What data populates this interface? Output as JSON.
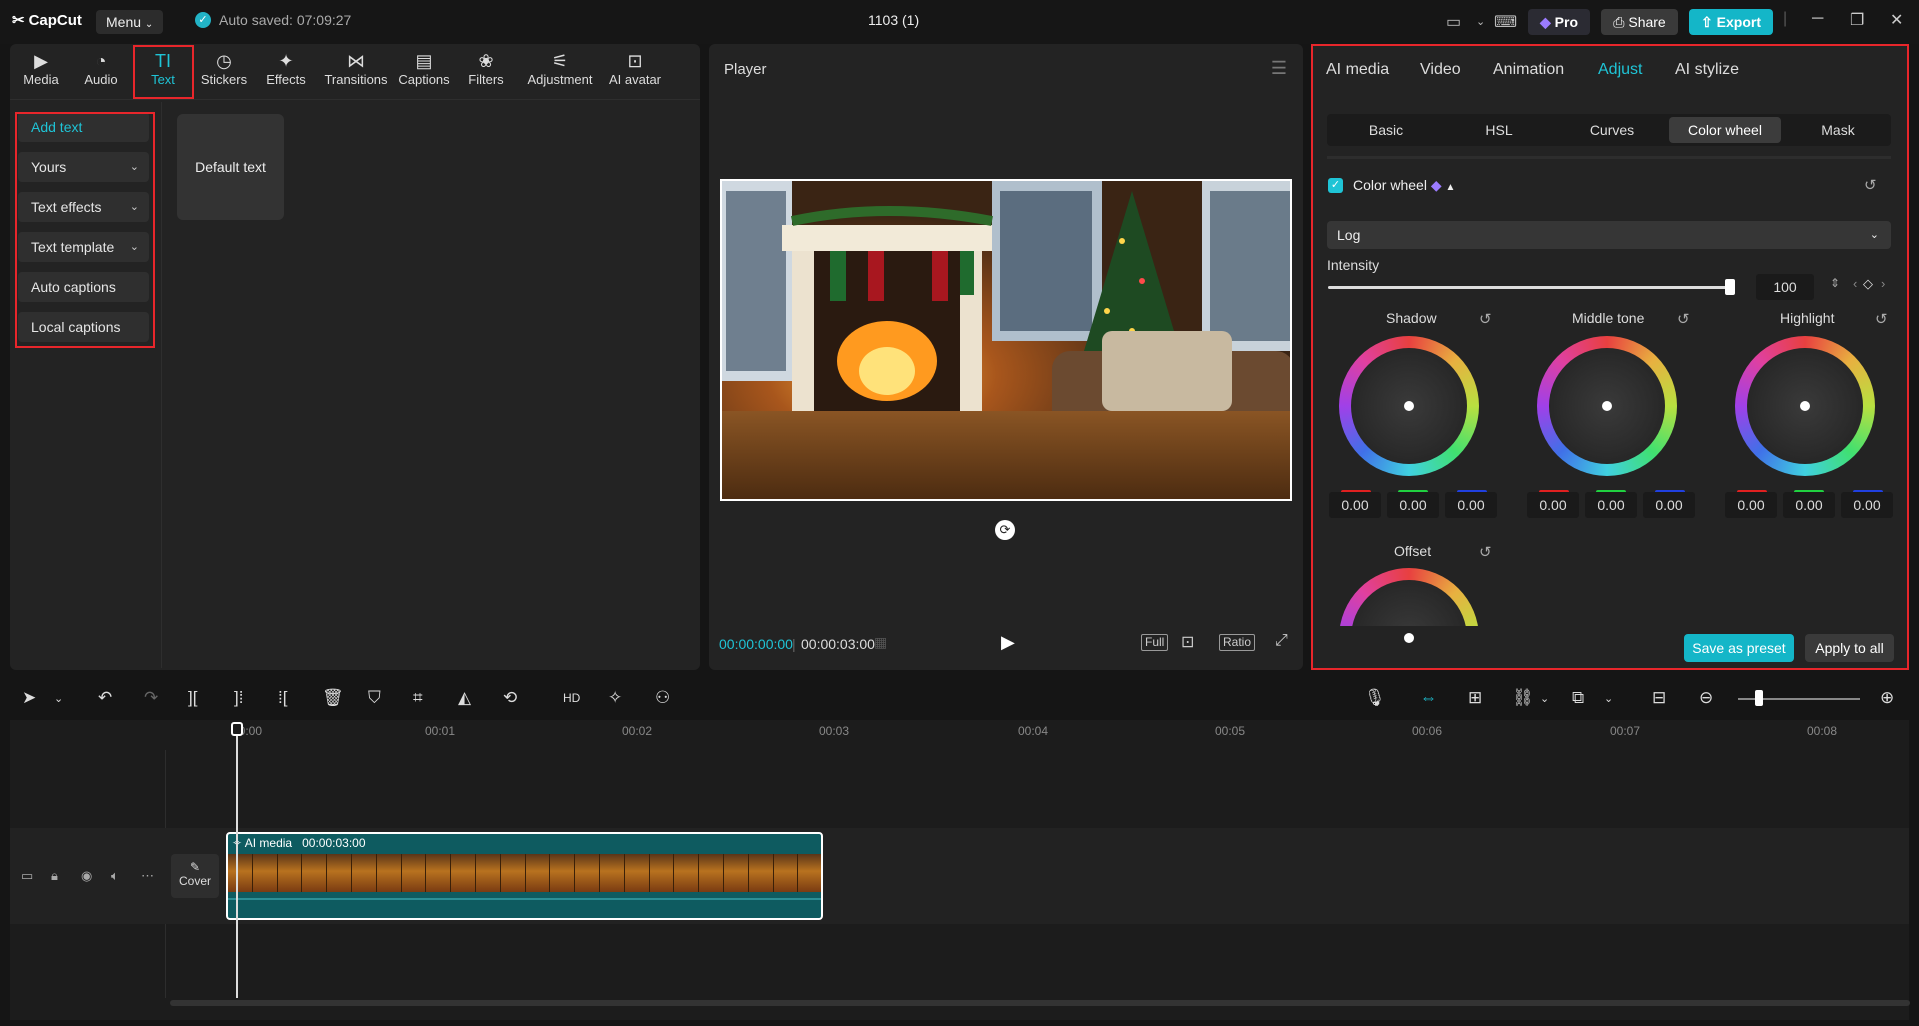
{
  "titlebar": {
    "logo": "CapCut",
    "menu_label": "Menu",
    "autosave_text": "Auto saved: 07:09:27",
    "project_name": "1103 (1)",
    "pro_label": "Pro",
    "share_label": "Share",
    "export_label": "Export"
  },
  "media_tabs": [
    {
      "label": "Media",
      "icon": "media-icon"
    },
    {
      "label": "Audio",
      "icon": "audio-icon"
    },
    {
      "label": "Text",
      "icon": "text-icon",
      "active": true
    },
    {
      "label": "Stickers",
      "icon": "stickers-icon"
    },
    {
      "label": "Effects",
      "icon": "effects-icon"
    },
    {
      "label": "Transitions",
      "icon": "transitions-icon"
    },
    {
      "label": "Captions",
      "icon": "captions-icon"
    },
    {
      "label": "Filters",
      "icon": "filters-icon"
    },
    {
      "label": "Adjustment",
      "icon": "adjustment-icon"
    },
    {
      "label": "AI avatar",
      "icon": "ai-avatar-icon"
    }
  ],
  "text_sidebar": [
    {
      "label": "Add text",
      "active": true
    },
    {
      "label": "Yours"
    },
    {
      "label": "Text effects"
    },
    {
      "label": "Text template"
    },
    {
      "label": "Auto captions"
    },
    {
      "label": "Local captions"
    }
  ],
  "default_text_card": "Default text",
  "player": {
    "title": "Player",
    "current_time": "00:00:00:00",
    "total_time": "00:00:03:00",
    "full_label": "Full",
    "ratio_label": "Ratio"
  },
  "adjust_panel": {
    "tabs": [
      "AI media",
      "Video",
      "Animation",
      "Adjust",
      "AI stylize"
    ],
    "active_tab": "Adjust",
    "subtabs": [
      "Basic",
      "HSL",
      "Curves",
      "Color wheel",
      "Mask"
    ],
    "active_subtab": "Color wheel",
    "color_wheel_label": "Color wheel",
    "mode_value": "Log",
    "intensity_label": "Intensity",
    "intensity_value": "100",
    "intensity_level": 100,
    "wheels": [
      {
        "label": "Shadow",
        "r": "0.00",
        "g": "0.00",
        "b": "0.00"
      },
      {
        "label": "Middle tone",
        "r": "0.00",
        "g": "0.00",
        "b": "0.00"
      },
      {
        "label": "Highlight",
        "r": "0.00",
        "g": "0.00",
        "b": "0.00"
      }
    ],
    "offset_label": "Offset",
    "save_preset_label": "Save as preset",
    "apply_all_label": "Apply to all"
  },
  "timeline": {
    "ruler": [
      "00:00",
      "00:01",
      "00:02",
      "00:03",
      "00:04",
      "00:05",
      "00:06",
      "00:07",
      "00:08"
    ],
    "clip_label": "AI media",
    "clip_duration": "00:00:03:00",
    "cover_label": "Cover"
  },
  "colors": {
    "accent": "#1fc4d6",
    "highlight_box": "#e8262b"
  }
}
